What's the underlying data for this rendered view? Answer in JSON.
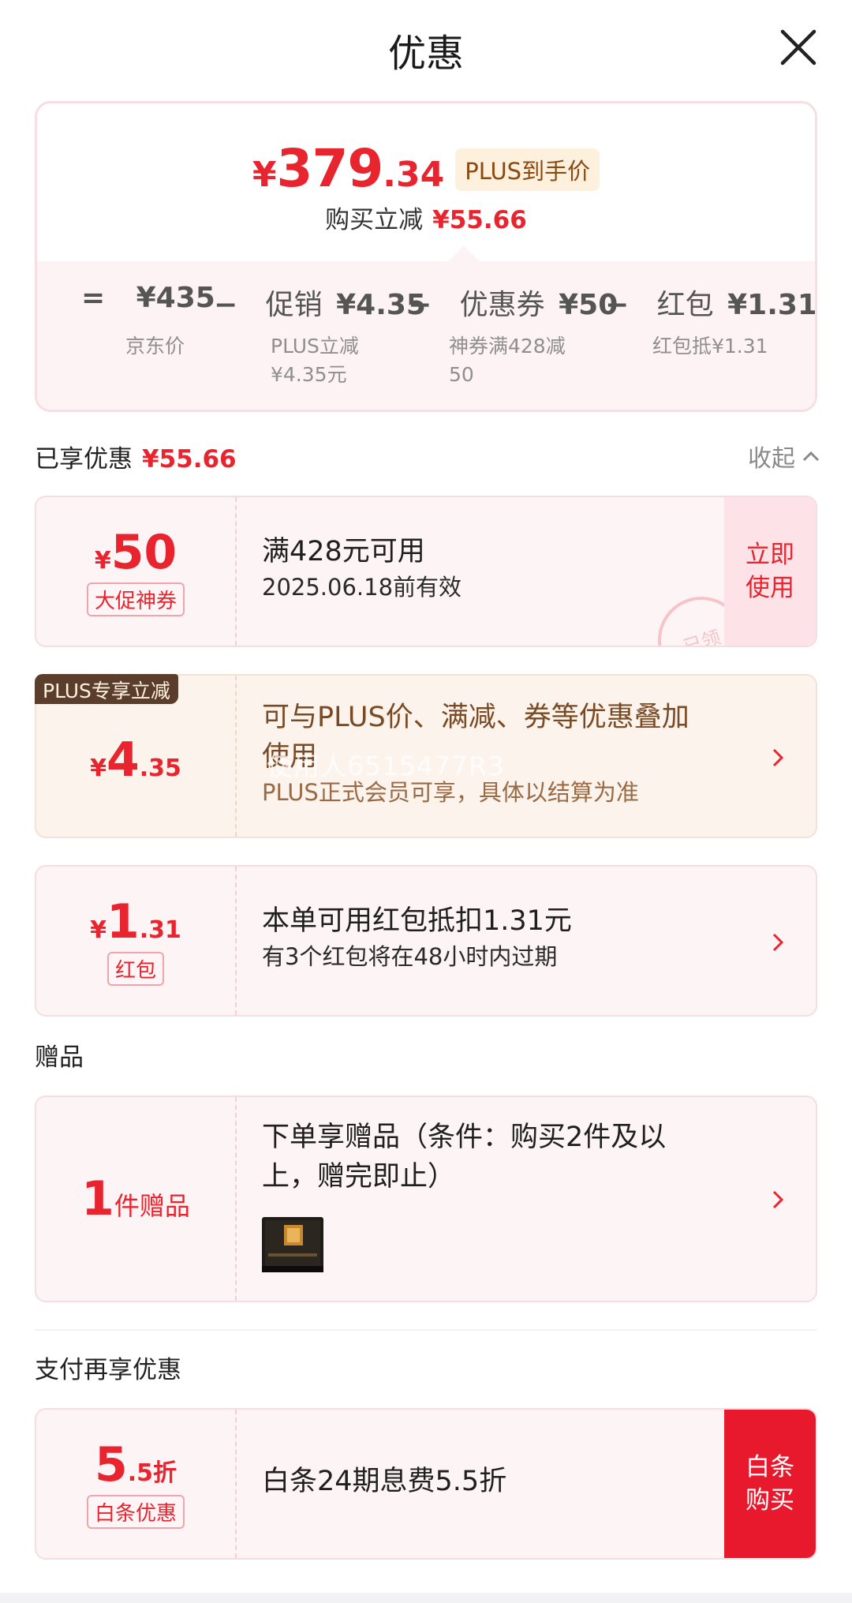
{
  "header": {
    "title": "优惠"
  },
  "summary": {
    "currency": "¥",
    "price_int": "379",
    "price_dec": ".34",
    "plus_tag": "PLUS到手价",
    "reduce_label": "购买立减",
    "reduce_amount": "¥55.66",
    "breakdown": [
      {
        "op": "=",
        "label": "",
        "value": "¥435",
        "sub": "京东价"
      },
      {
        "op": "−",
        "label": "促销",
        "value": "¥4.35",
        "sub": "PLUS立减\n¥4.35元"
      },
      {
        "op": "−",
        "label": "优惠券",
        "value": "¥50",
        "sub": "神券满428减\n50"
      },
      {
        "op": "−",
        "label": "红包",
        "value": "¥1.31",
        "sub": "红包抵¥1.31"
      }
    ]
  },
  "enjoyed": {
    "label": "已享优惠",
    "amount": "¥55.66",
    "collapse": "收起"
  },
  "coupon": {
    "yen": "¥",
    "value": "50",
    "chip": "大促神券",
    "line1": "满428元可用",
    "line2": "2025.06.18前有效",
    "button": "立即使用",
    "button_l1": "立即",
    "button_l2": "使用",
    "stamp": "已领"
  },
  "plus": {
    "badge": "PLUS专享立减",
    "yen": "¥",
    "int": "4",
    "dec": ".35",
    "line1a": "可与PLUS价、满减、券等优惠叠加",
    "line1b": "使用",
    "line2": "PLUS正式会员可享，具体以结算为准",
    "watermark": "使用人6515477R3"
  },
  "redpacket": {
    "yen": "¥",
    "int": "1",
    "dec": ".31",
    "chip": "红包",
    "line1": "本单可用红包抵扣1.31元",
    "line2": "有3个红包将在48小时内过期"
  },
  "gift_section": {
    "title": "赠品"
  },
  "gift": {
    "count": "1",
    "unit": "件赠品",
    "line1a": "下单享赠品（条件：购买2件及以",
    "line1b": "上，赠完即止）"
  },
  "pay_section": {
    "title": "支付再享优惠"
  },
  "baitiao": {
    "int": "5",
    "dec": ".5",
    "unit": "折",
    "chip": "白条优惠",
    "line1": "白条24期息费5.5折",
    "button_l1": "白条",
    "button_l2": "购买"
  },
  "colors": {
    "accent": "#e8242e",
    "plus_brown": "#5a3d2b",
    "card_bg": "#fdf4f5",
    "button_red": "#e8192c"
  }
}
